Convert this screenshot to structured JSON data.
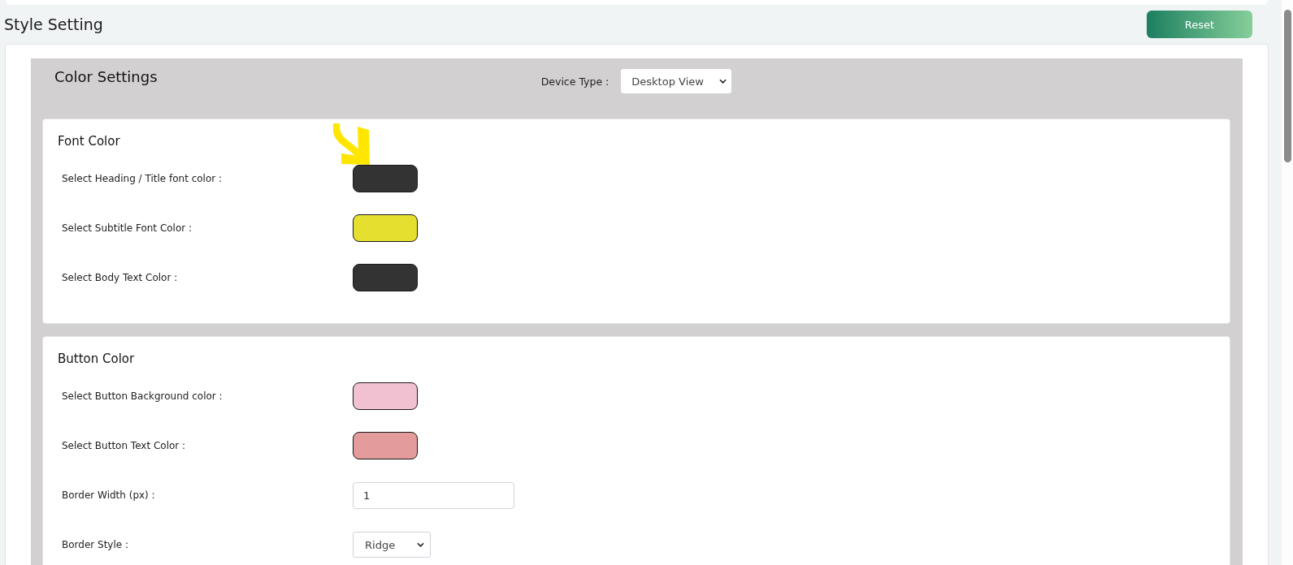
{
  "page": {
    "title": "Style Setting",
    "reset_button": "Reset"
  },
  "color_settings": {
    "title": "Color Settings",
    "device_type": {
      "label": "Device Type :",
      "value": "Desktop View"
    }
  },
  "sections": [
    {
      "title": "Font Color",
      "fields": [
        {
          "kind": "color",
          "label": "Select Heading / Title font color :",
          "color": "#333333"
        },
        {
          "kind": "color",
          "label": "Select Subtitle Font Color :",
          "color": "#e5df2f"
        },
        {
          "kind": "color",
          "label": "Select Body Text Color :",
          "color": "#333333"
        }
      ]
    },
    {
      "title": "Button Color",
      "fields": [
        {
          "kind": "color",
          "label": "Select Button Background color :",
          "color": "#f2c1d1"
        },
        {
          "kind": "color",
          "label": "Select Button Text Color :",
          "color": "#e39b9b"
        },
        {
          "kind": "number",
          "label": "Border Width (px) :",
          "value": "1"
        },
        {
          "kind": "select",
          "label": "Border Style :",
          "value": "Ridge"
        }
      ]
    }
  ]
}
